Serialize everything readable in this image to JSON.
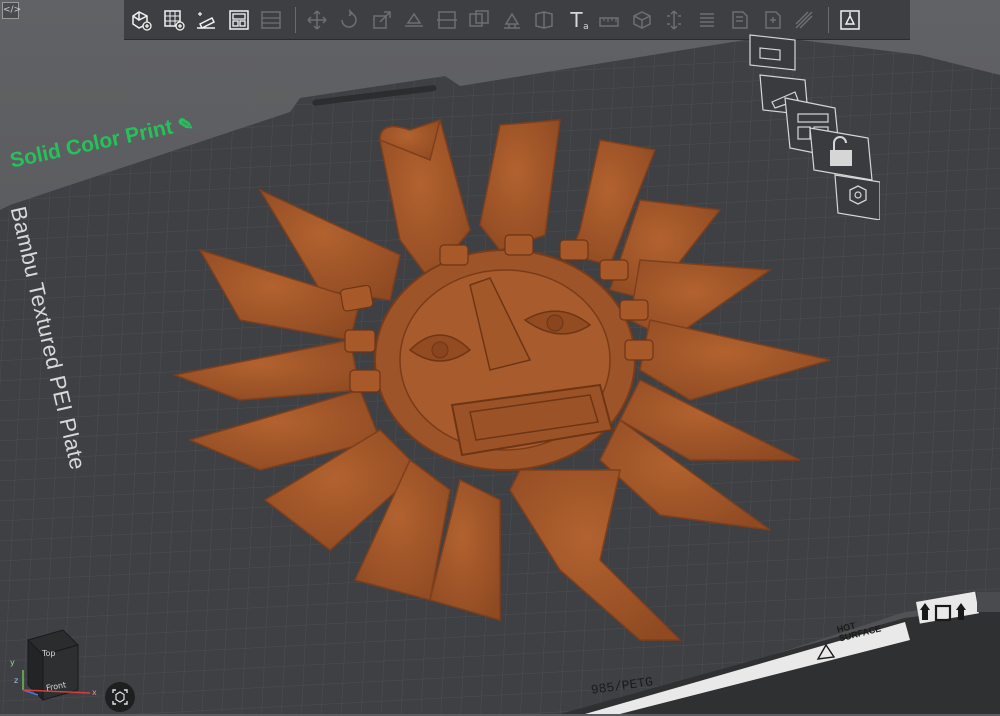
{
  "toolbar": {
    "items": [
      {
        "name": "add-object",
        "active": true
      },
      {
        "name": "add-plate",
        "active": true
      },
      {
        "name": "auto-orient",
        "active": true
      },
      {
        "name": "arrange",
        "active": true
      },
      {
        "name": "split-layout",
        "active": false
      },
      {
        "name": "move",
        "active": false
      },
      {
        "name": "rotate",
        "active": false
      },
      {
        "name": "scale",
        "active": false
      },
      {
        "name": "lay-on-face",
        "active": false
      },
      {
        "name": "cut",
        "active": false
      },
      {
        "name": "boolean",
        "active": false
      },
      {
        "name": "support-paint",
        "active": false
      },
      {
        "name": "seam-paint",
        "active": false
      },
      {
        "name": "text",
        "active": true
      },
      {
        "name": "measure",
        "active": false
      },
      {
        "name": "assembly",
        "active": false
      },
      {
        "name": "variable-layer",
        "active": false
      },
      {
        "name": "fuzzy-skin",
        "active": false
      },
      {
        "name": "color-paint",
        "active": false
      },
      {
        "name": "edit-object",
        "active": false
      },
      {
        "name": "brim-ear",
        "active": false
      },
      {
        "name": "view-mode",
        "active": true
      }
    ],
    "text_tool_glyph": "T",
    "text_tool_sub": "a"
  },
  "plate": {
    "name": "Bambu Textured PEI Plate",
    "annotation": "Solid Color Print",
    "filament_label": "985/PETG",
    "hot_surface_line1": "HOT",
    "hot_surface_line2": "SURFACE"
  },
  "plate_side_tools": [
    "plate-arrange",
    "plate-auto-orient",
    "plate-lock",
    "plate-settings"
  ],
  "view_cube": {
    "top": "Top",
    "front": "Front",
    "x": "x",
    "y": "y",
    "z": "z"
  },
  "colors": {
    "model": "#a65a2b",
    "plate": "#3f4043",
    "grid": "#4c4d50",
    "background": "#5c5d60",
    "annotation": "#24c25a",
    "toolbar": "#3e3f42"
  }
}
